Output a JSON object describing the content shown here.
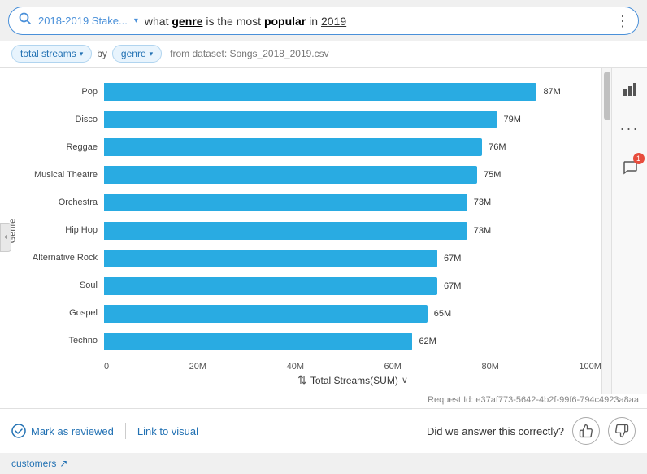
{
  "header": {
    "search_icon": "🔍",
    "project_name": "2018-2019 Stake...",
    "chevron": "▾",
    "query": {
      "prefix": "what ",
      "word1": "genre",
      "middle": " is the most ",
      "word2": "popular",
      "suffix": " in ",
      "word3": "2019"
    },
    "more_icon": "⋮"
  },
  "filters": {
    "metric_label": "total streams",
    "by_label": "by",
    "group_label": "genre",
    "dataset_label": "from dataset: Songs_2018_2019.csv"
  },
  "chart": {
    "y_axis_label": "Genre",
    "x_axis_label": "Total Streams(SUM)",
    "x_ticks": [
      "0",
      "20M",
      "40M",
      "60M",
      "80M",
      "100M"
    ],
    "bars": [
      {
        "label": "Pop",
        "value": "87M",
        "pct": 87
      },
      {
        "label": "Disco",
        "value": "79M",
        "pct": 79
      },
      {
        "label": "Reggae",
        "value": "76M",
        "pct": 76
      },
      {
        "label": "Musical Theatre",
        "value": "75M",
        "pct": 75
      },
      {
        "label": "Orchestra",
        "value": "73M",
        "pct": 73
      },
      {
        "label": "Hip Hop",
        "value": "73M",
        "pct": 73
      },
      {
        "label": "Alternative Rock",
        "value": "67M",
        "pct": 67
      },
      {
        "label": "Soul",
        "value": "67M",
        "pct": 67
      },
      {
        "label": "Gospel",
        "value": "65M",
        "pct": 65
      },
      {
        "label": "Techno",
        "value": "62M",
        "pct": 62
      }
    ],
    "bar_color": "#29abe2",
    "sort_icon": "⇅",
    "chevron_down": "∨"
  },
  "request_id": "Request Id: e37af773-5642-4b2f-99f6-794c4923a8aa",
  "right_panel": {
    "chart_icon": "📊",
    "more_icon": "⋯",
    "comment_icon": "💬",
    "comment_badge": "1"
  },
  "bottom": {
    "check_icon": "✓",
    "mark_reviewed": "Mark as reviewed",
    "link_visual": "Link to visual",
    "answer_question": "Did we answer this correctly?",
    "thumb_up_icon": "👍",
    "thumb_down_icon": "👎"
  },
  "bottom_strip": {
    "text": "customers",
    "icon": "↗"
  }
}
